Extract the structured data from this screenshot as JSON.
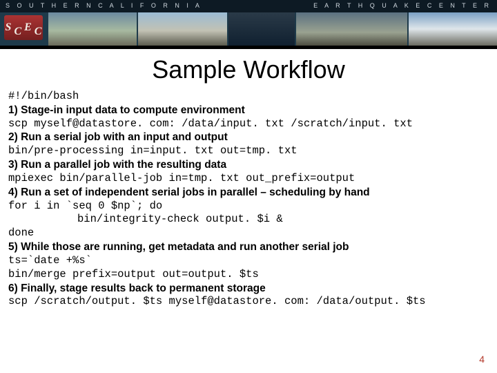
{
  "banner": {
    "left_text": "S O U T H E R N   C A L I F O R N I A",
    "right_text": "E A R T H Q U A K E   C E N T E R",
    "logo": {
      "s": "S",
      "c": "C",
      "e": "E",
      "c2": "C"
    }
  },
  "title": "Sample Workflow",
  "lines": {
    "shebang": "#!/bin/bash",
    "step1": "1) Stage-in input data to compute environment",
    "scp1": "scp myself@datastore. com: /data/input. txt /scratch/input. txt",
    "step2": "2) Run a serial job with an input and output",
    "pre": "bin/pre-processing in=input. txt out=tmp. txt",
    "step3": "3) Run a parallel job with the resulting data",
    "mpi": "mpiexec bin/parallel-job in=tmp. txt out_prefix=output",
    "step4": "4) Run a set of independent serial jobs in parallel – scheduling by hand",
    "for": "for i in `seq 0 $np`; do",
    "check": "bin/integrity-check output. $i &",
    "done": "done",
    "step5": "5) While those are running, get metadata and run another serial job",
    "ts": "ts=`date +%s`",
    "merge": "bin/merge prefix=output out=output. $ts",
    "step6": "6) Finally, stage results back to permanent storage",
    "scp2": "scp /scratch/output. $ts myself@datastore. com: /data/output. $ts"
  },
  "page_number": "4"
}
